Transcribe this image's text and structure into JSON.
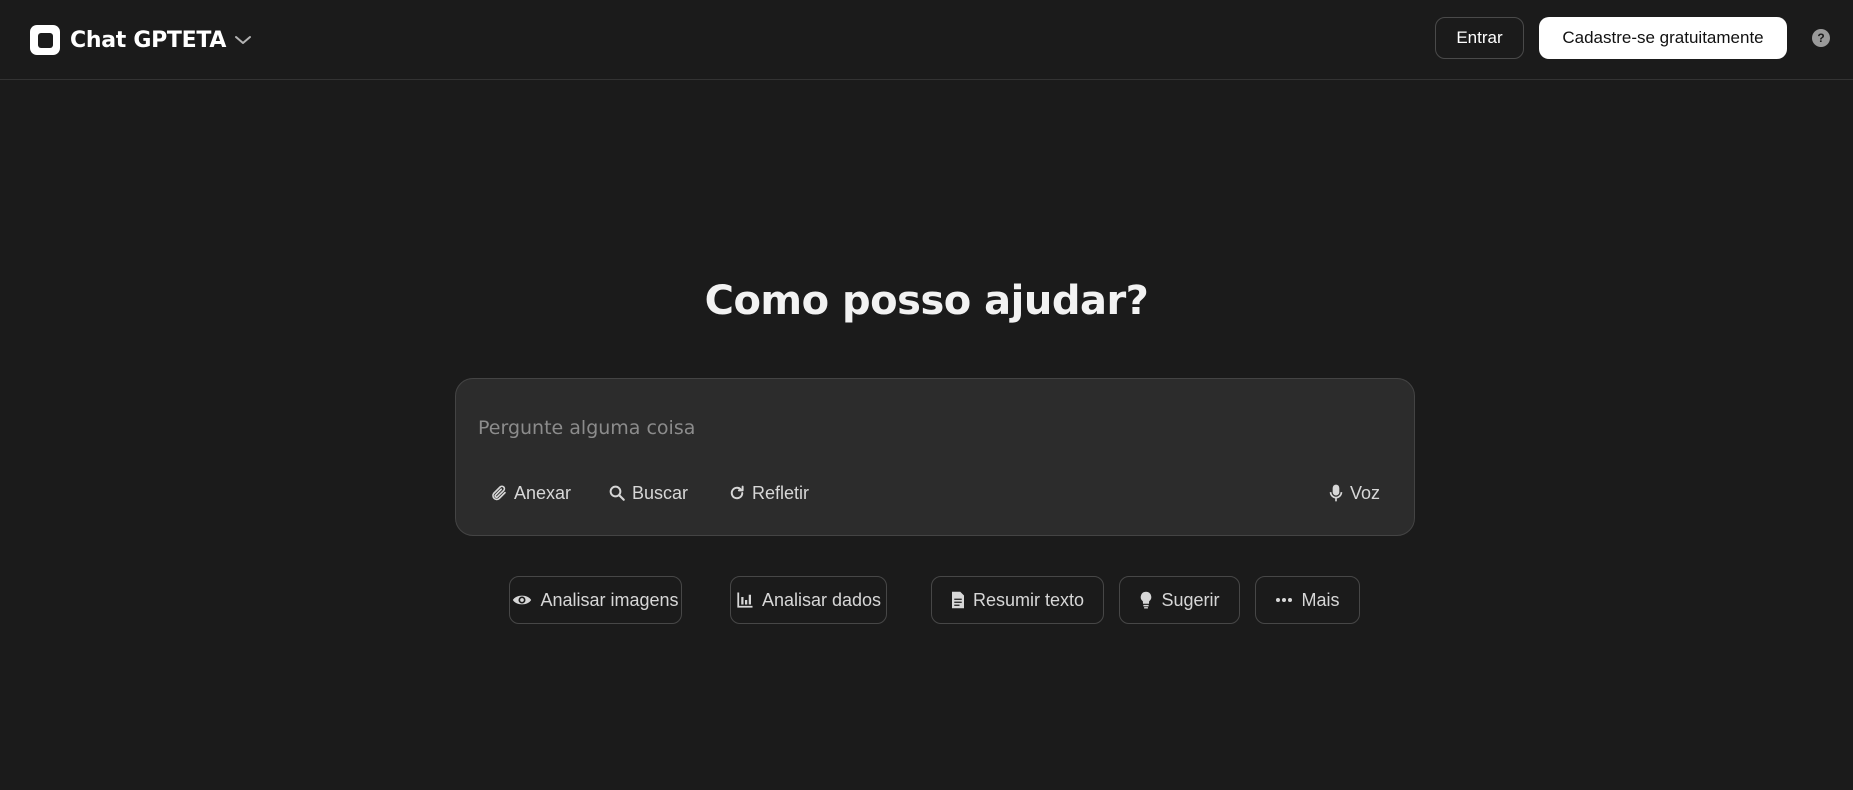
{
  "header": {
    "brand_name": "Chat GPTETA",
    "login_label": "Entrar",
    "signup_label": "Cadastre-se gratuitamente",
    "help_symbol": "?"
  },
  "main": {
    "heading": "Como posso ajudar?",
    "composer": {
      "placeholder": "Pergunte alguma coisa",
      "value": "",
      "tools": {
        "attach": "Anexar",
        "search": "Buscar",
        "reason": "Refletir",
        "voice": "Voz"
      }
    },
    "chips": {
      "analyze_images": "Analisar imagens",
      "analyze_data": "Analisar dados",
      "summarize_text": "Resumir texto",
      "suggest": "Sugerir",
      "more": "Mais"
    }
  },
  "colors": {
    "background": "#1b1b1b",
    "composer_bg": "#2c2c2c",
    "signup_bg": "#ffffff",
    "text": "#ececec"
  },
  "icons": {
    "brand": "app-logo-icon",
    "brand_dropdown": "chevron-down-icon",
    "help": "help-icon",
    "attach": "paperclip-icon",
    "search": "search-icon",
    "reason": "refresh-icon",
    "voice": "microphone-icon",
    "analyze_images": "eye-icon",
    "analyze_data": "bar-chart-icon",
    "summarize_text": "document-icon",
    "suggest": "lightbulb-icon",
    "more": "ellipsis-icon"
  }
}
